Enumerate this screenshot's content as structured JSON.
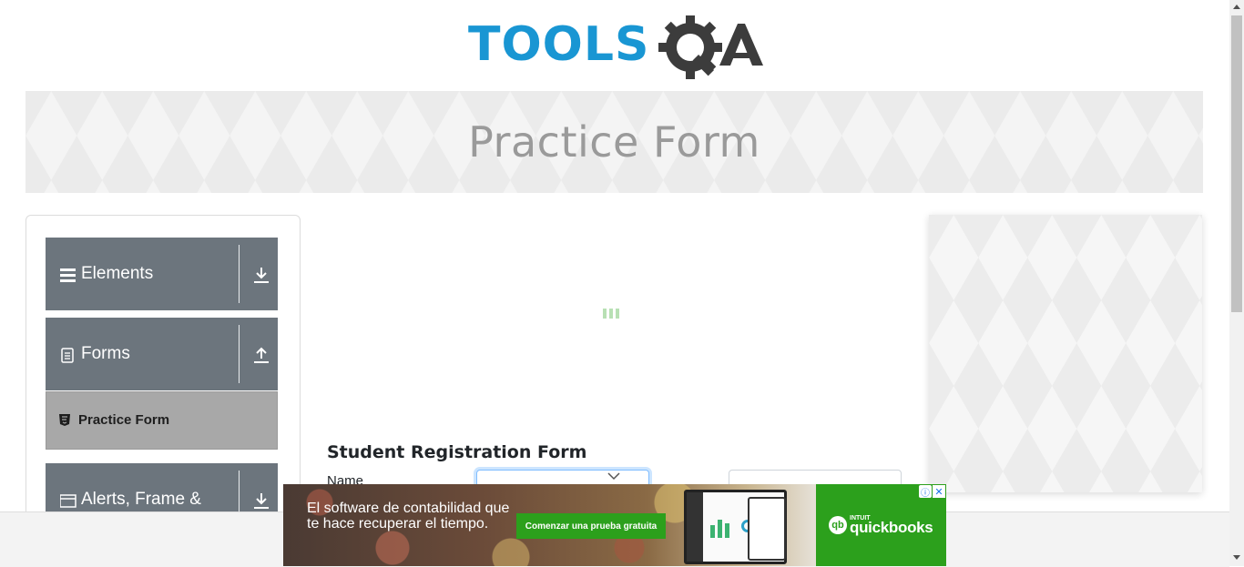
{
  "header": {
    "logo_text_tools": "TOOLS",
    "logo_text_qa": "QA",
    "brand_blue": "#1996d3",
    "brand_dark": "#3c3c3c"
  },
  "banner": {
    "title": "Practice Form"
  },
  "sidebar": {
    "groups": [
      {
        "label": "Elements",
        "icon": "hamburger-icon",
        "arrow": "download-arrow-icon"
      },
      {
        "label": "Forms",
        "icon": "document-icon",
        "arrow": "upload-arrow-icon"
      },
      {
        "label": "Alerts, Frame &",
        "icon": "window-icon",
        "arrow": "download-arrow-icon"
      }
    ],
    "active_item": {
      "label": "Practice Form",
      "icon": "html5-icon"
    },
    "header_color": "#6c757d",
    "active_color": "#a8a8a8"
  },
  "form": {
    "title": "Student Registration Form",
    "name_label": "Name",
    "first_name_value": "",
    "last_name_value": ""
  },
  "ad": {
    "headline": "El software de contabilidad que te hace recuperar el tiempo.",
    "cta": "Comenzar una prueba gratuita",
    "brand_small": "INTUIT",
    "brand": "quickbooks",
    "brand_mark": "qb",
    "adchoices": "ⓘ",
    "close": "✕",
    "brand_color": "#2ca01c"
  }
}
